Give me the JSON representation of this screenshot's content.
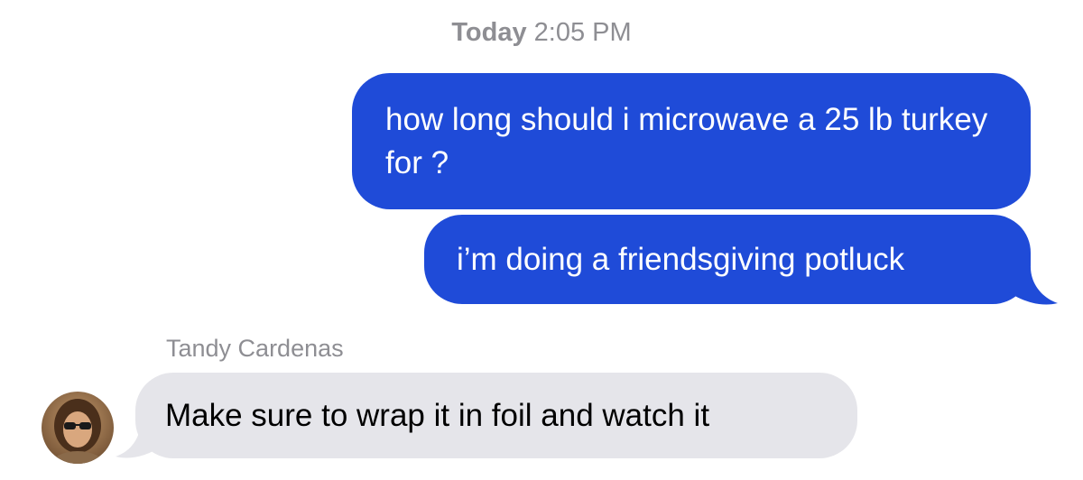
{
  "conversation": {
    "timestamp": {
      "day": "Today",
      "time": "2:05 PM"
    },
    "outgoing": [
      {
        "text": "how long should i microwave a 25 lb turkey for ?"
      },
      {
        "text": "i’m doing a friendsgiving potluck"
      }
    ],
    "incoming": {
      "sender_name": "Tandy Cardenas",
      "text": "Make sure to wrap it in foil and watch it"
    }
  },
  "colors": {
    "outgoing_bubble": "#1f4bd8",
    "incoming_bubble": "#e5e5ea",
    "meta_text": "#8e8e93"
  }
}
